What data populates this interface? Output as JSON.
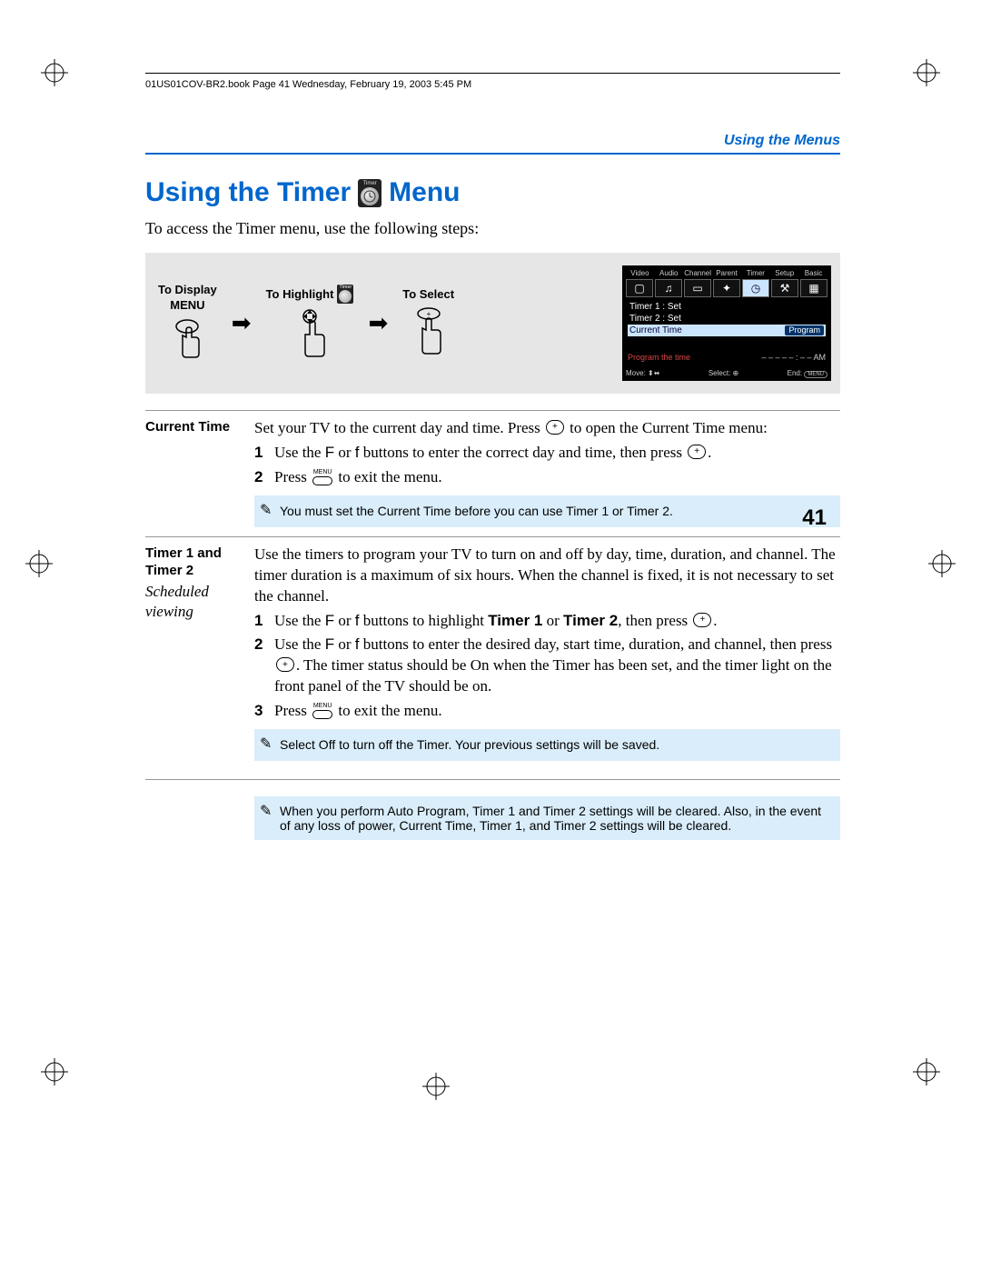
{
  "header_text": "01US01COV-BR2.book  Page 41  Wednesday, February 19, 2003  5:45 PM",
  "section_header": "Using the Menus",
  "title_part1": "Using the Timer",
  "title_part2": "Menu",
  "timer_icon_label": "Timer",
  "intro": "To access the Timer menu, use the following steps:",
  "steps": {
    "display": "To Display",
    "menu": "MENU",
    "highlight": "To Highlight",
    "select": "To Select"
  },
  "osd": {
    "tabs": [
      "Video",
      "Audio",
      "Channel",
      "Parent",
      "Timer",
      "Setup",
      "Basic"
    ],
    "rows": [
      {
        "l": "Timer 1 : Set",
        "r": ""
      },
      {
        "l": "Timer 2 : Set",
        "r": ""
      },
      {
        "l": "Current Time",
        "r": "Program",
        "hl": true
      }
    ],
    "msg_l": "Program the time",
    "msg_r": "– – –   – – : – – AM",
    "foot": {
      "move": "Move:",
      "select": "Select:",
      "end": "End:",
      "endv": "MENU"
    }
  },
  "sec1": {
    "label": "Current Time",
    "p": "Set your TV to the current day and time. Press       to open the Current Time menu:",
    "li1a": "Use the ",
    "li1b": " or ",
    "li1c": " buttons to enter the correct day and time, then press ",
    "li1d": ".",
    "li2a": "Press ",
    "li2b": " to exit the menu.",
    "note": "You must set the Current Time before you can use Timer 1 or Timer 2."
  },
  "sec2": {
    "label1": "Timer 1 and Timer 2",
    "label2": "Scheduled viewing",
    "p": "Use the timers to program your TV to turn on and off by day, time, duration, and channel. The timer duration is a maximum of six hours. When the channel is fixed, it is not necessary to set the channel.",
    "li1a": "Use the ",
    "li1b": " or ",
    "li1c": " buttons to highlight ",
    "li1bold1": "Timer 1",
    "li1d": " or ",
    "li1bold2": "Timer 2",
    "li1e": ", then press ",
    "li1f": ".",
    "li2a": "Use the ",
    "li2b": " or ",
    "li2c": " buttons to enter the desired day, start time, duration, and channel, then press ",
    "li2d": ". The timer status should be On when the Timer has been set, and the timer light on the front panel of the TV should be on.",
    "li3a": "Press ",
    "li3b": " to exit the menu.",
    "note": "Select Off to turn off the Timer. Your previous settings will be saved."
  },
  "note3": "When you perform Auto Program, Timer 1 and Timer 2 settings will be cleared. Also, in the event of any loss of power, Current Time, Timer 1, and Timer 2 settings will be cleared.",
  "page_num": "41",
  "glyphs": {
    "F": "F",
    "f": "f",
    "plus": "+",
    "menu": "MENU"
  }
}
